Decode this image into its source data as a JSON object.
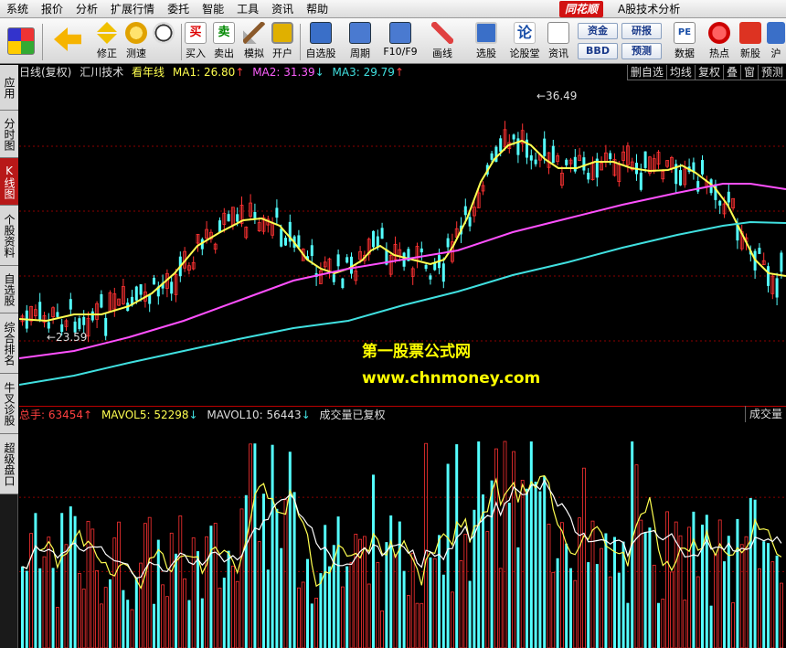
{
  "menu": {
    "items": [
      "系统",
      "报价",
      "分析",
      "扩展行情",
      "委托",
      "智能",
      "工具",
      "资讯",
      "帮助"
    ],
    "brand": "同花顺",
    "title": "A股技术分析"
  },
  "toolbar": {
    "buttons": [
      {
        "label": "",
        "icon": "grid-icon"
      },
      {
        "label": "",
        "icon": "back-arrow-icon"
      },
      {
        "label": "修正",
        "icon": "up-down-icon"
      },
      {
        "label": "测速",
        "icon": "speed-icon"
      },
      {
        "label": "",
        "icon": "clock-icon"
      },
      {
        "label": "买入",
        "icon": "buy-icon",
        "char": "买"
      },
      {
        "label": "卖出",
        "icon": "sell-icon",
        "char": "卖"
      },
      {
        "label": "模拟",
        "icon": "hammer-icon"
      },
      {
        "label": "开户",
        "icon": "lock-icon"
      },
      {
        "label": "自选股",
        "icon": "star-icon"
      },
      {
        "label": "周期",
        "icon": "period-icon"
      },
      {
        "label": "F10/F9",
        "icon": "f10-icon"
      },
      {
        "label": "画线",
        "icon": "pen-icon"
      },
      {
        "label": "选股",
        "icon": "screen-icon"
      },
      {
        "label": "论股堂",
        "icon": "lun-icon",
        "char": "论"
      },
      {
        "label": "资讯",
        "icon": "news-icon"
      },
      {
        "label": "数据",
        "icon": "pe-icon",
        "char": "PE"
      },
      {
        "label": "热点",
        "icon": "hot-icon"
      },
      {
        "label": "新股",
        "icon": "new-stock-icon"
      },
      {
        "label": "沪",
        "icon": "sh-icon"
      }
    ],
    "small_buttons": [
      "资金",
      "研报",
      "BBD",
      "预测"
    ]
  },
  "left_tabs": [
    {
      "label": "应用",
      "active": false
    },
    {
      "label": "分时图",
      "active": false
    },
    {
      "label": "K线图",
      "active": true
    },
    {
      "label": "个股资料",
      "active": false
    },
    {
      "label": "自选股",
      "active": false
    },
    {
      "label": "综合排名",
      "active": false
    },
    {
      "label": "牛叉诊股",
      "active": false
    },
    {
      "label": "超级盘口",
      "active": false
    }
  ],
  "kline_header": {
    "period": "日线(复权)",
    "stock": "汇川技术",
    "view": "看年线",
    "ma1_label": "MA1: 26.80",
    "ma1_arrow": "↑",
    "ma2_label": "MA2: 31.39",
    "ma2_arrow": "↓",
    "ma3_label": "MA3: 29.79",
    "ma3_arrow": "↑",
    "buttons": [
      "删自选",
      "均线",
      "复权",
      "叠",
      "窗",
      "预测"
    ]
  },
  "volume_header": {
    "total": "总手: 63454",
    "total_arrow": "↑",
    "mavol5": "MAVOL5: 52298",
    "mavol5_arrow": "↓",
    "mavol10": "MAVOL10: 56443",
    "mavol10_arrow": "↓",
    "note": "成交量已复权",
    "button": "成交量"
  },
  "annotations": {
    "high": "36.49",
    "low": "23.59"
  },
  "watermark": {
    "line1": "第一股票公式网",
    "line2": "www.chnmoney.com"
  },
  "colors": {
    "up": "#ff3232",
    "down": "#54ffff",
    "ma1": "#ffff50",
    "ma2": "#ff50ff",
    "ma3": "#40e0e0",
    "grid": "#8b0000"
  }
}
